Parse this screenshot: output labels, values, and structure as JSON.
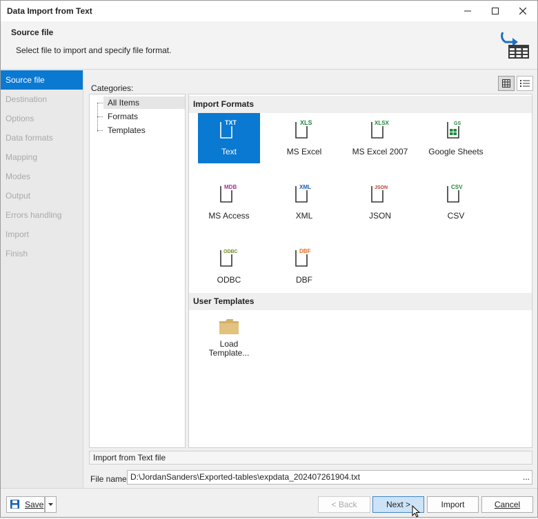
{
  "window": {
    "title": "Data Import from Text",
    "minimize_icon": "minimize-icon",
    "maximize_icon": "maximize-icon",
    "close_icon": "close-icon"
  },
  "header": {
    "title": "Source file",
    "subtitle": "Select file to import and specify file format.",
    "icon": "import-table-icon"
  },
  "nav": {
    "items": [
      {
        "label": "Source file",
        "active": true
      },
      {
        "label": "Destination",
        "active": false
      },
      {
        "label": "Options",
        "active": false
      },
      {
        "label": "Data formats",
        "active": false
      },
      {
        "label": "Mapping",
        "active": false
      },
      {
        "label": "Modes",
        "active": false
      },
      {
        "label": "Output",
        "active": false
      },
      {
        "label": "Errors handling",
        "active": false
      },
      {
        "label": "Import",
        "active": false
      },
      {
        "label": "Finish",
        "active": false
      }
    ]
  },
  "categories": {
    "label": "Categories:",
    "items": [
      "All Items",
      "Formats",
      "Templates"
    ],
    "selected": "All Items"
  },
  "view_buttons": {
    "grid_icon": "grid-view-icon",
    "list_icon": "list-view-icon",
    "selected": "grid"
  },
  "import_formats": {
    "header": "Import Formats",
    "items": [
      {
        "label": "Text",
        "badge": "TXT",
        "color": "#3a3a3a",
        "selected": true
      },
      {
        "label": "MS Excel",
        "badge": "XLS",
        "color": "#1f8a3a"
      },
      {
        "label": "MS Excel 2007",
        "badge": "XLSX",
        "color": "#1f8a3a"
      },
      {
        "label": "Google Sheets",
        "badge": "GS",
        "color": "#1f8a3a"
      },
      {
        "label": "MS Access",
        "badge": "MDB",
        "color": "#a2358f"
      },
      {
        "label": "XML",
        "badge": "XML",
        "color": "#1b5fb5"
      },
      {
        "label": "JSON",
        "badge": "JSON",
        "color": "#c0392b"
      },
      {
        "label": "CSV",
        "badge": "CSV",
        "color": "#1f8a3a"
      },
      {
        "label": "ODBC",
        "badge": "ODBC",
        "color": "#6d8a1a"
      },
      {
        "label": "DBF",
        "badge": "DBF",
        "color": "#e36b1a"
      }
    ]
  },
  "user_templates": {
    "header": "User Templates",
    "load_line1": "Load",
    "load_line2": "Template...",
    "icon": "folder-icon"
  },
  "info_text": "Import from Text file",
  "file_name": {
    "label": "File name:",
    "value": "D:\\JordanSanders\\Exported-tables\\expdata_202407261904.txt",
    "browse": "..."
  },
  "buttons": {
    "save": "Save",
    "back": "< Back",
    "next": "Next >",
    "import": "Import",
    "cancel": "Cancel"
  }
}
